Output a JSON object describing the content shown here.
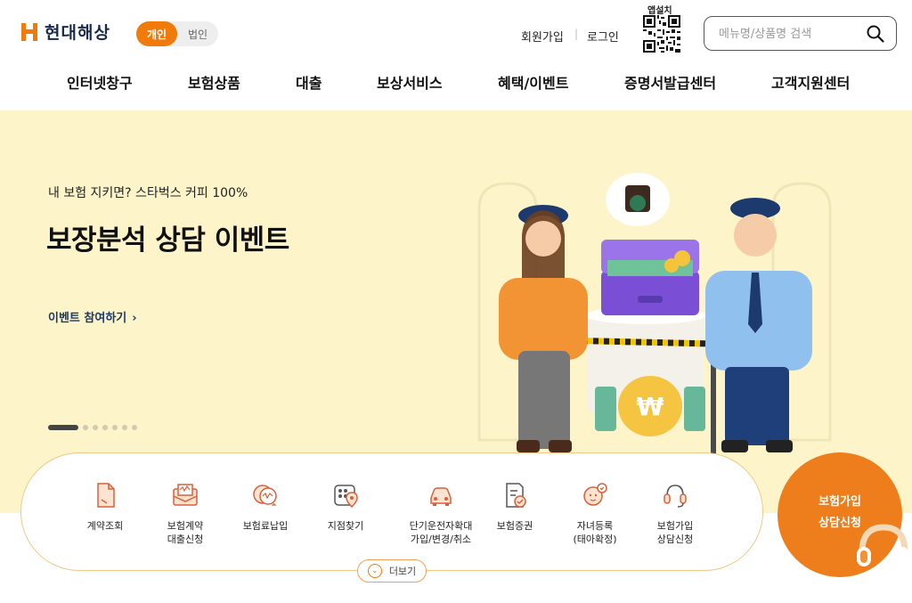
{
  "brand": {
    "name": "현대해상",
    "accent": "#f07a0a",
    "hero_bg": "#fdf5c9"
  },
  "segment": {
    "personal": "개인",
    "corporate": "법인",
    "selected": "개인"
  },
  "util": {
    "join": "회원가입",
    "separator": "|",
    "login": "로그인",
    "app_install": "앱설치"
  },
  "search": {
    "placeholder": "메뉴명/상품명 검색",
    "value": "",
    "icon": "search-icon"
  },
  "gnb": [
    {
      "label": "인터넷창구"
    },
    {
      "label": "보험상품"
    },
    {
      "label": "대출"
    },
    {
      "label": "보상서비스"
    },
    {
      "label": "혜택/이벤트"
    },
    {
      "label": "증명서발급센터"
    },
    {
      "label": "고객지원센터"
    }
  ],
  "hero": {
    "subtitle": "내 보험 지키면? 스타벅스 커피 100%",
    "title": "보장분석 상담 이벤트",
    "cta": "이벤트 참여하기",
    "slide_count": 8,
    "active_slide": 1
  },
  "quick_menu": [
    {
      "label": "계약조회",
      "icon": "document-icon"
    },
    {
      "label": "보험계약\n대출신청",
      "icon": "envelope-money-icon"
    },
    {
      "label": "보험료납입",
      "icon": "card-payment-icon"
    },
    {
      "label": "지점찾기",
      "icon": "map-pin-icon"
    },
    {
      "label": "단기운전자확대\n가입/변경/취소",
      "icon": "car-icon"
    },
    {
      "label": "보험증권",
      "icon": "certificate-icon"
    },
    {
      "label": "자녀등록\n(태아확정)",
      "icon": "baby-icon"
    },
    {
      "label": "보험가입\n상담신청",
      "icon": "headset-icon"
    }
  ],
  "more": {
    "label": "더보기"
  },
  "consult": {
    "label": "보험가입\n상담신청"
  }
}
